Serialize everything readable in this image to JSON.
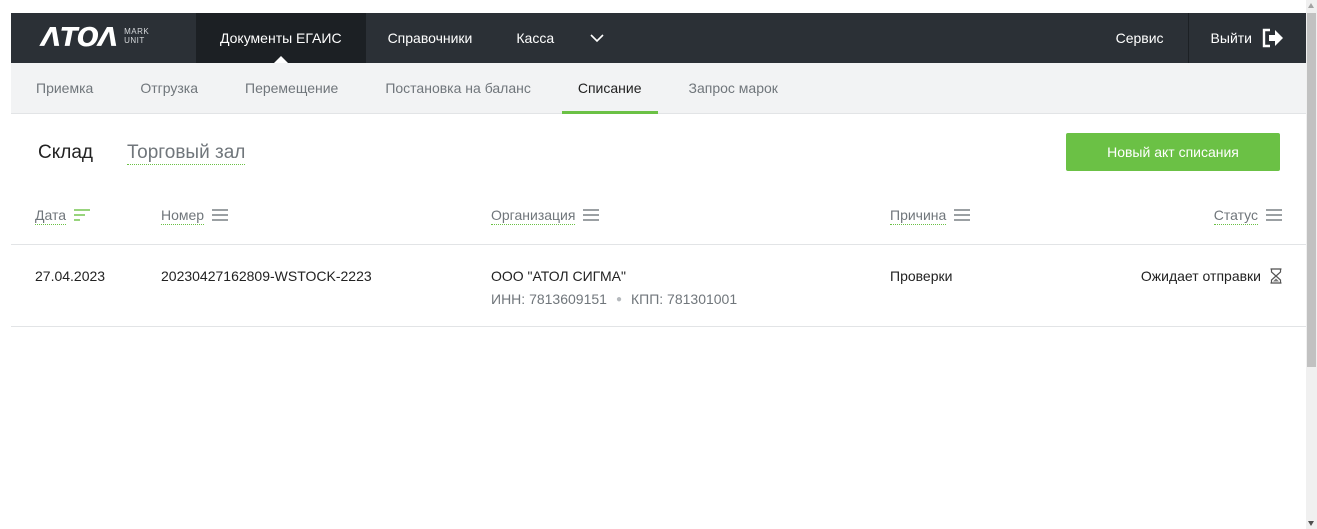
{
  "brand": {
    "mark": "ΛΤΟΛ",
    "sub_top": "MARK",
    "sub_bottom": "UNIT"
  },
  "topnav": {
    "items": [
      {
        "label": "Документы ЕГАИС",
        "active": true
      },
      {
        "label": "Справочники",
        "active": false
      },
      {
        "label": "Касса",
        "active": false
      }
    ],
    "more_icon": "chevron-down-icon",
    "service_label": "Сервис",
    "exit_label": "Выйти",
    "exit_icon": "exit-icon"
  },
  "subtabs": [
    {
      "label": "Приемка",
      "active": false
    },
    {
      "label": "Отгрузка",
      "active": false
    },
    {
      "label": "Перемещение",
      "active": false
    },
    {
      "label": "Постановка на баланс",
      "active": false
    },
    {
      "label": "Списание",
      "active": true
    },
    {
      "label": "Запрос марок",
      "active": false
    }
  ],
  "section": {
    "tabs": [
      {
        "label": "Склад",
        "active": true
      },
      {
        "label": "Торговый зал",
        "active": false
      }
    ],
    "new_button_label": "Новый акт списания"
  },
  "table": {
    "columns": [
      {
        "label": "Дата",
        "icon": "filter-lines-icon"
      },
      {
        "label": "Номер",
        "icon": "menu-icon"
      },
      {
        "label": "Организация",
        "icon": "menu-icon"
      },
      {
        "label": "Причина",
        "icon": "menu-icon"
      },
      {
        "label": "Статус",
        "icon": "menu-icon"
      }
    ],
    "rows": [
      {
        "date": "27.04.2023",
        "number": "20230427162809-WSTOCK-2223",
        "organization": "ООО \"АТОЛ СИГМА\"",
        "inn": "ИНН: 7813609151",
        "kpp": "КПП: 781301001",
        "reason": "Проверки",
        "status": "Ожидает отправки",
        "status_icon": "hourglass-icon"
      }
    ]
  },
  "colors": {
    "topbar": "#2b3036",
    "topbar_active": "#1c2024",
    "accent_green": "#6bc145",
    "subbar": "#f2f3f4",
    "muted_text": "#70767b"
  }
}
